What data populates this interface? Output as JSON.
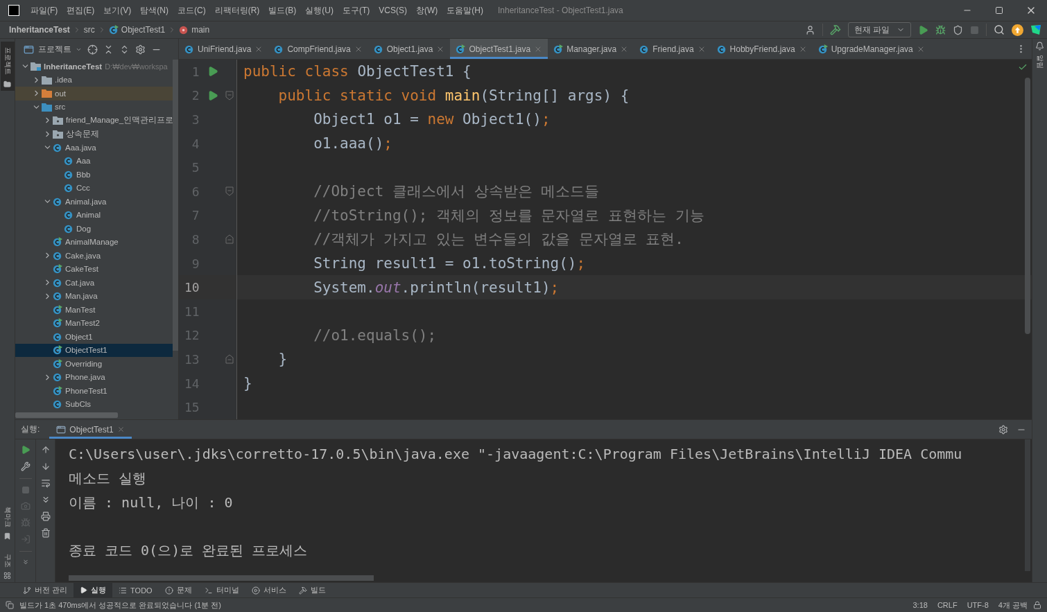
{
  "window": {
    "title": "InheritanceTest - ObjectTest1.java"
  },
  "menu": [
    "파일(F)",
    "편집(E)",
    "보기(V)",
    "탐색(N)",
    "코드(C)",
    "리팩터링(R)",
    "빌드(B)",
    "실행(U)",
    "도구(T)",
    "VCS(S)",
    "창(W)",
    "도움말(H)"
  ],
  "breadcrumbs": [
    {
      "text": "InheritanceTest",
      "kind": "project"
    },
    {
      "text": "src",
      "kind": "folder"
    },
    {
      "text": "ObjectTest1",
      "kind": "class"
    },
    {
      "text": "main",
      "kind": "method"
    }
  ],
  "run_config": "현재 파일",
  "left_stripe": [
    {
      "label": "프로젝트",
      "kind": "top",
      "selected": true
    },
    {
      "label": "북마크",
      "kind": "bottom",
      "selected": false
    },
    {
      "label": "구조",
      "kind": "bottom",
      "selected": false
    }
  ],
  "right_stripe": [
    {
      "label": "알림"
    }
  ],
  "project_panel": {
    "title": "프로젝트",
    "tree": [
      {
        "name": "InheritanceTest",
        "hint": "D:₩dev₩workspa",
        "kind": "module",
        "expanded": true,
        "selected": false,
        "children": [
          {
            "name": ".idea",
            "kind": "folder",
            "expanded": false,
            "selected": false
          },
          {
            "name": "out",
            "kind": "excluded",
            "expanded": false,
            "selected": false
          },
          {
            "name": "src",
            "kind": "source",
            "expanded": true,
            "selected": false,
            "children": [
              {
                "name": "friend_Manage_인맥관리프로",
                "kind": "package",
                "expanded": false,
                "selected": false
              },
              {
                "name": "상속문제",
                "kind": "package",
                "expanded": false,
                "selected": false
              },
              {
                "name": "Aaa.java",
                "kind": "class",
                "expanded": true,
                "selected": false,
                "children": [
                  {
                    "name": "Aaa",
                    "kind": "class",
                    "selected": false
                  },
                  {
                    "name": "Bbb",
                    "kind": "class",
                    "selected": false
                  },
                  {
                    "name": "Ccc",
                    "kind": "class",
                    "selected": false
                  }
                ]
              },
              {
                "name": "Animal.java",
                "kind": "class",
                "expanded": true,
                "selected": false,
                "children": [
                  {
                    "name": "Animal",
                    "kind": "class",
                    "selected": false
                  },
                  {
                    "name": "Dog",
                    "kind": "class",
                    "selected": false
                  }
                ]
              },
              {
                "name": "AnimalManage",
                "kind": "runnable",
                "selected": false
              },
              {
                "name": "Cake.java",
                "kind": "class",
                "expanded": false,
                "selected": false
              },
              {
                "name": "CakeTest",
                "kind": "runnable",
                "selected": false
              },
              {
                "name": "Cat.java",
                "kind": "class",
                "expanded": false,
                "selected": false
              },
              {
                "name": "Man.java",
                "kind": "class",
                "expanded": false,
                "selected": false
              },
              {
                "name": "ManTest",
                "kind": "runnable",
                "selected": false
              },
              {
                "name": "ManTest2",
                "kind": "runnable",
                "selected": false
              },
              {
                "name": "Object1",
                "kind": "class",
                "selected": false
              },
              {
                "name": "ObjectTest1",
                "kind": "runnable",
                "selected": true
              },
              {
                "name": "Overriding",
                "kind": "runnable",
                "selected": false
              },
              {
                "name": "Phone.java",
                "kind": "class",
                "expanded": false,
                "selected": false
              },
              {
                "name": "PhoneTest1",
                "kind": "runnable",
                "selected": false
              },
              {
                "name": "SubCls",
                "kind": "class",
                "selected": false
              }
            ]
          }
        ]
      }
    ]
  },
  "editor_tabs": [
    {
      "label": "UniFriend.java",
      "kind": "class",
      "selected": false
    },
    {
      "label": "CompFriend.java",
      "kind": "class",
      "selected": false
    },
    {
      "label": "Object1.java",
      "kind": "class",
      "selected": false
    },
    {
      "label": "ObjectTest1.java",
      "kind": "runnable",
      "selected": true
    },
    {
      "label": "Manager.java",
      "kind": "runnable",
      "selected": false
    },
    {
      "label": "Friend.java",
      "kind": "class",
      "selected": false
    },
    {
      "label": "HobbyFriend.java",
      "kind": "class",
      "selected": false
    },
    {
      "label": "UpgradeManager.java",
      "kind": "runnable",
      "selected": false
    }
  ],
  "code_lines": [
    {
      "number": "1",
      "run": true,
      "fold_start": false,
      "fold_end": false,
      "current": false,
      "tokens": [
        {
          "text": "public class ",
          "kind": "keyword"
        },
        {
          "text": "ObjectTest1 {",
          "kind": "plain"
        }
      ]
    },
    {
      "number": "2",
      "run": true,
      "fold_start": true,
      "fold_end": false,
      "current": false,
      "tokens": [
        {
          "text": "    public static void ",
          "kind": "keyword"
        },
        {
          "text": "main",
          "kind": "function"
        },
        {
          "text": "(String[] args) {",
          "kind": "plain"
        }
      ]
    },
    {
      "number": "3",
      "run": false,
      "fold_start": false,
      "fold_end": false,
      "current": false,
      "tokens": [
        {
          "text": "        Object1 o1 = ",
          "kind": "plain"
        },
        {
          "text": "new ",
          "kind": "keyword"
        },
        {
          "text": "Object1()",
          "kind": "plain"
        },
        {
          "text": ";",
          "kind": "keyword"
        }
      ]
    },
    {
      "number": "4",
      "run": false,
      "fold_start": false,
      "fold_end": false,
      "current": false,
      "tokens": [
        {
          "text": "        o1.aaa()",
          "kind": "plain"
        },
        {
          "text": ";",
          "kind": "keyword"
        }
      ]
    },
    {
      "number": "5",
      "run": false,
      "fold_start": false,
      "fold_end": false,
      "current": false
    },
    {
      "number": "6",
      "run": false,
      "fold_start": true,
      "fold_end": false,
      "current": false,
      "tokens": [
        {
          "text": "        //Object 클래스에서 상속받은 메소드들",
          "kind": "comment"
        }
      ]
    },
    {
      "number": "7",
      "run": false,
      "fold_start": false,
      "fold_end": false,
      "current": false,
      "tokens": [
        {
          "text": "        //toString(); 객체의 정보를 문자열로 표현하는 기능",
          "kind": "comment"
        }
      ]
    },
    {
      "number": "8",
      "run": false,
      "fold_start": false,
      "fold_end": true,
      "current": false,
      "tokens": [
        {
          "text": "        //객체가 가지고 있는 변수들의 값을 문자열로 표현.",
          "kind": "comment"
        }
      ]
    },
    {
      "number": "9",
      "run": false,
      "fold_start": false,
      "fold_end": false,
      "current": false,
      "tokens": [
        {
          "text": "        String result1 = o1.toString()",
          "kind": "plain"
        },
        {
          "text": ";",
          "kind": "keyword"
        }
      ]
    },
    {
      "number": "10",
      "run": false,
      "fold_start": false,
      "fold_end": false,
      "current": true,
      "tokens": [
        {
          "text": "        System.",
          "kind": "plain"
        },
        {
          "text": "out",
          "kind": "field"
        },
        {
          "text": ".println(result1)",
          "kind": "plain"
        },
        {
          "text": ";",
          "kind": "keyword"
        }
      ]
    },
    {
      "number": "11",
      "run": false,
      "fold_start": false,
      "fold_end": false,
      "current": false
    },
    {
      "number": "12",
      "run": false,
      "fold_start": false,
      "fold_end": false,
      "current": false,
      "tokens": [
        {
          "text": "        //o1.equals();",
          "kind": "comment"
        }
      ]
    },
    {
      "number": "13",
      "run": false,
      "fold_start": false,
      "fold_end": true,
      "current": false,
      "tokens": [
        {
          "text": "    }",
          "kind": "plain"
        }
      ]
    },
    {
      "number": "14",
      "run": false,
      "fold_start": false,
      "fold_end": false,
      "current": false,
      "tokens": [
        {
          "text": "}",
          "kind": "plain"
        }
      ]
    },
    {
      "number": "15",
      "run": false,
      "fold_start": false,
      "fold_end": false,
      "current": false
    }
  ],
  "run_panel": {
    "label": "실행:",
    "tabs": [
      {
        "label": "ObjectTest1",
        "selected": true
      }
    ],
    "console": [
      {
        "text": "C:\\Users\\user\\.jdks\\corretto-17.0.5\\bin\\java.exe \"-javaagent:C:\\Program Files\\JetBrains\\IntelliJ IDEA Commu",
        "kind": "command"
      },
      {
        "text": "메소드 실행",
        "kind": "output"
      },
      {
        "text": "이름 : null, 나이 : 0",
        "kind": "output"
      },
      {
        "text": "종료 코드 0(으)로 완료된 프로세스",
        "kind": "exit"
      }
    ]
  },
  "tool_strip": [
    {
      "label": "버전 관리",
      "kind": "vcs",
      "selected": false
    },
    {
      "label": "실행",
      "kind": "run",
      "selected": true
    },
    {
      "label": "TODO",
      "kind": "todo",
      "selected": false
    },
    {
      "label": "문제",
      "kind": "problems",
      "selected": false
    },
    {
      "label": "터미널",
      "kind": "terminal",
      "selected": false
    },
    {
      "label": "서비스",
      "kind": "services",
      "selected": false
    },
    {
      "label": "빌드",
      "kind": "build",
      "selected": false
    }
  ],
  "status_bar": {
    "message": "빌드가 1초 470ms에서 성공적으로 완료되었습니다 (1분 전)",
    "items": [
      "3:18",
      "CRLF",
      "UTF-8",
      "4개 공백"
    ]
  }
}
